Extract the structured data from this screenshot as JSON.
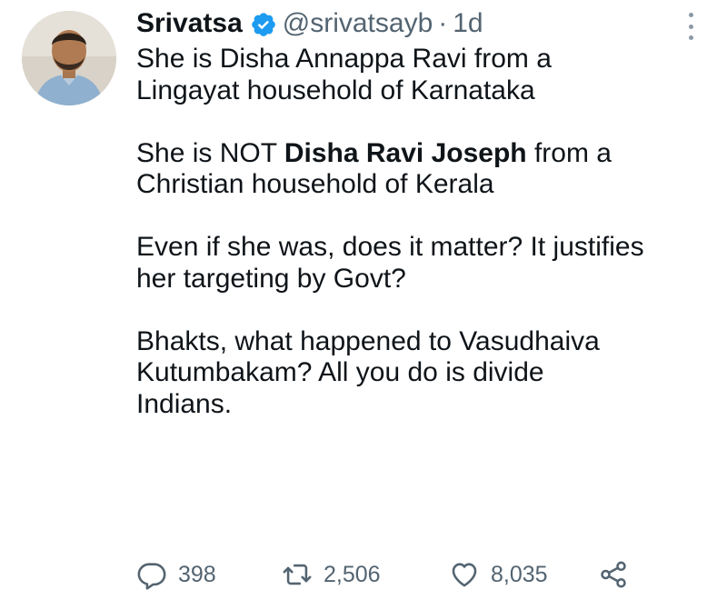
{
  "tweet": {
    "author_name": "Srivatsa",
    "handle": "@srivatsayb",
    "separator": "·",
    "time": "1d",
    "verified_icon": "verified-badge-icon",
    "avatar_icon": "profile-photo",
    "paragraphs": {
      "p1_line1": "She is Disha Annappa Ravi from a",
      "p1_line2": "Lingayat household of Karnataka",
      "p2_pre": "She is NOT ",
      "p2_bold": "Disha Ravi Joseph",
      "p2_post": " from a",
      "p2_line2": "Christian household of Kerala",
      "p3_line1": "Even if she was, does it matter? It justifies",
      "p3_line2": "her targeting by Govt?",
      "p4_line1": "Bhakts, what happened to Vasudhaiva",
      "p4_line2": "Kutumbakam? All you do is divide",
      "p4_line3": "Indians."
    }
  },
  "actions": {
    "reply_count": "398",
    "retweet_count": "2,506",
    "like_count": "8,035",
    "reply_icon": "reply-icon",
    "retweet_icon": "retweet-icon",
    "like_icon": "heart-icon",
    "share_icon": "share-icon"
  },
  "colors": {
    "text": "#0f1419",
    "muted": "#536471",
    "verified": "#1d9bf0"
  }
}
